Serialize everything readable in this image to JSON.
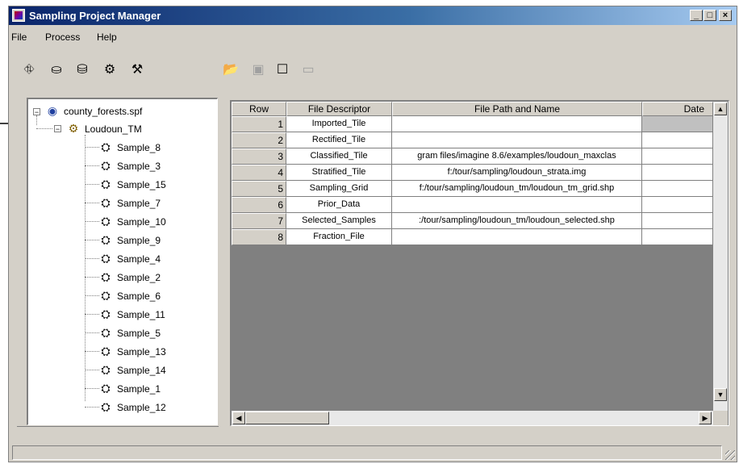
{
  "window": {
    "title": "Sampling Project Manager",
    "title_buttons": [
      "_",
      "□",
      "×"
    ]
  },
  "menu": {
    "items": [
      "File",
      "Process",
      "Help"
    ]
  },
  "toolbar": {
    "icons": [
      "new-project-icon",
      "add-icon",
      "remove-icon",
      "settings-icon",
      "tools-icon",
      "open-folder-icon",
      "table-icon",
      "window-icon",
      "blank-icon"
    ]
  },
  "tree": {
    "root": "county_forests.spf",
    "project": "Loudoun_TM",
    "samples": [
      "Sample_8",
      "Sample_3",
      "Sample_15",
      "Sample_7",
      "Sample_10",
      "Sample_9",
      "Sample_4",
      "Sample_2",
      "Sample_6",
      "Sample_11",
      "Sample_5",
      "Sample_13",
      "Sample_14",
      "Sample_1",
      "Sample_12"
    ]
  },
  "table": {
    "headers": [
      "Row",
      "File Descriptor",
      "File Path and Name",
      "Date"
    ],
    "rows": [
      {
        "row": "1",
        "descriptor": "Imported_Tile",
        "path": "",
        "date": ""
      },
      {
        "row": "2",
        "descriptor": "Rectified_Tile",
        "path": "",
        "date": ""
      },
      {
        "row": "3",
        "descriptor": "Classified_Tile",
        "path": "gram files/imagine 8.6/examples/loudoun_maxclas",
        "date": ""
      },
      {
        "row": "4",
        "descriptor": "Stratified_Tile",
        "path": "f:/tour/sampling/loudoun_strata.img",
        "date": ""
      },
      {
        "row": "5",
        "descriptor": "Sampling_Grid",
        "path": "f:/tour/sampling/loudoun_tm/loudoun_tm_grid.shp",
        "date": ""
      },
      {
        "row": "6",
        "descriptor": "Prior_Data",
        "path": "",
        "date": ""
      },
      {
        "row": "7",
        "descriptor": "Selected_Samples",
        "path": ":/tour/sampling/loudoun_tm/loudoun_selected.shp",
        "date": ""
      },
      {
        "row": "8",
        "descriptor": "Fraction_File",
        "path": "",
        "date": ""
      }
    ]
  }
}
